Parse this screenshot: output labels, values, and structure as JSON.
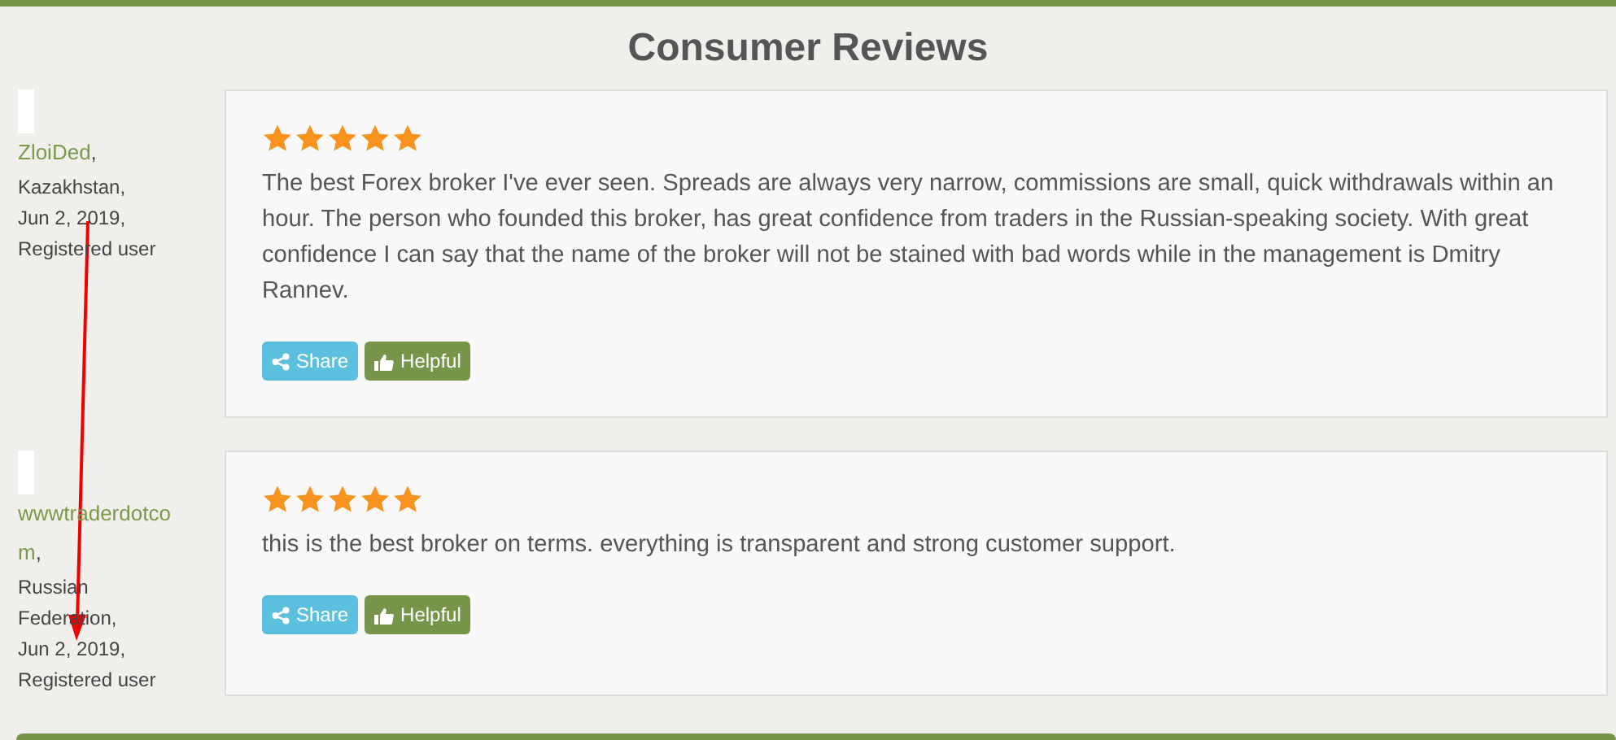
{
  "title": "Consumer Reviews",
  "reviews": [
    {
      "author": "ZloiDed",
      "author_punct": ",",
      "country": "Kazakhstan,",
      "date": "Jun 2, 2019,",
      "status": "Registered user",
      "stars": 5,
      "text": "The best Forex broker I've ever seen. Spreads are always very narrow, commissions are small, quick withdrawals within an hour. The person who founded this broker, has great confidence from traders in the Russian-speaking society. With great confidence I can say that the name of the broker will not be stained with bad words while in the management is Dmitry Rannev.",
      "buttons": [
        "Share",
        "Helpful"
      ]
    },
    {
      "author": "wwwtraderdotcom",
      "author_punct": ",",
      "country": "Russian Federation,",
      "date": "Jun 2, 2019,",
      "status": "Registered user",
      "stars": 5,
      "text": "this is the best broker on terms. everything is transparent and strong customer support.",
      "buttons": [
        "Share",
        "Helpful"
      ]
    }
  ]
}
